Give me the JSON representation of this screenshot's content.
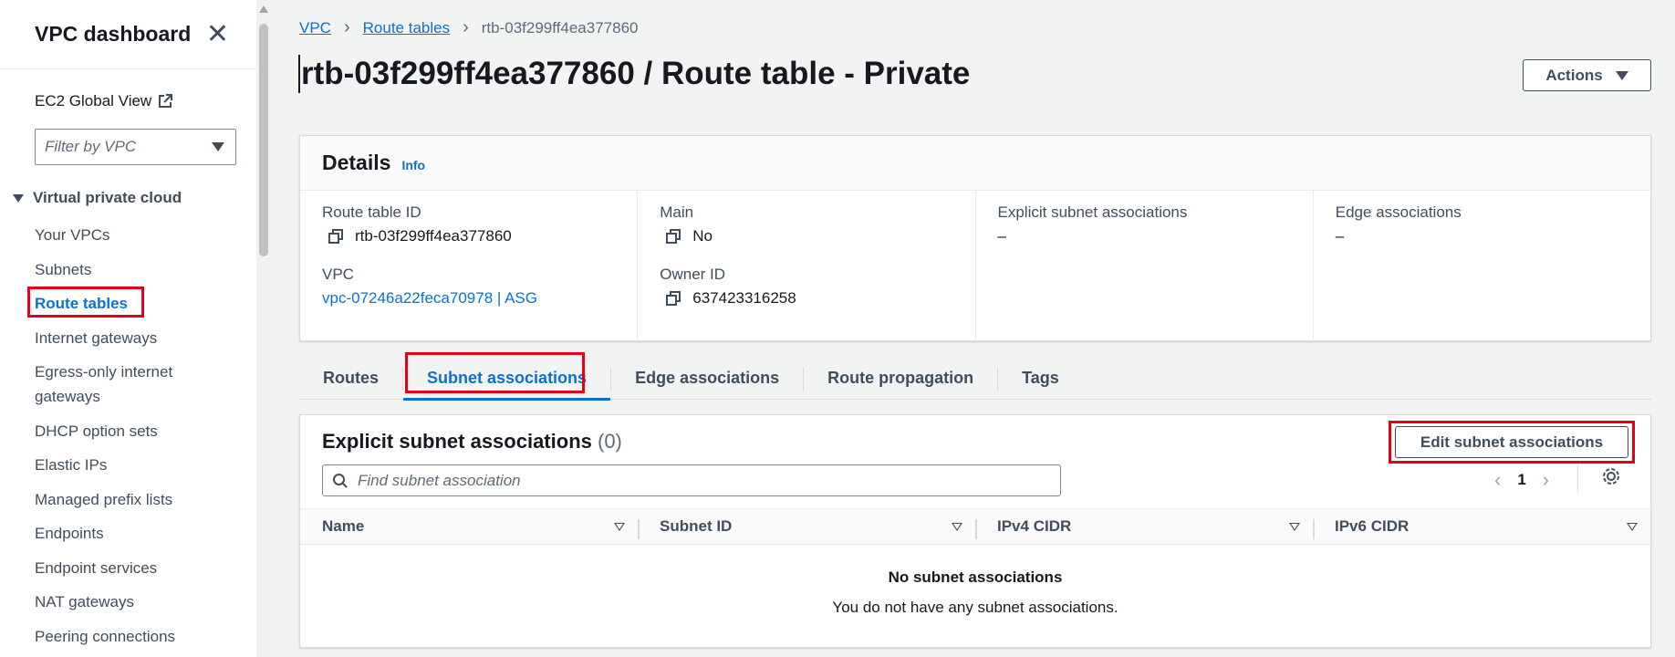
{
  "sidebar": {
    "title": "VPC dashboard",
    "ec2_global_view": "EC2 Global View",
    "filter_placeholder": "Filter by VPC",
    "section": "Virtual private cloud",
    "items": [
      {
        "label": "Your VPCs"
      },
      {
        "label": "Subnets"
      },
      {
        "label": "Route tables"
      },
      {
        "label": "Internet gateways"
      },
      {
        "label": "Egress-only internet gateways"
      },
      {
        "label": "DHCP option sets"
      },
      {
        "label": "Elastic IPs"
      },
      {
        "label": "Managed prefix lists"
      },
      {
        "label": "Endpoints"
      },
      {
        "label": "Endpoint services"
      },
      {
        "label": "NAT gateways"
      },
      {
        "label": "Peering connections"
      }
    ]
  },
  "breadcrumb": {
    "root": "VPC",
    "parent": "Route tables",
    "current": "rtb-03f299ff4ea377860"
  },
  "page": {
    "title": "rtb-03f299ff4ea377860 / Route table - Private",
    "actions_label": "Actions"
  },
  "details": {
    "heading": "Details",
    "info": "Info",
    "route_table_id_label": "Route table ID",
    "route_table_id": "rtb-03f299ff4ea377860",
    "vpc_label": "VPC",
    "vpc_value": "vpc-07246a22feca70978 | ASG",
    "main_label": "Main",
    "main_value": "No",
    "owner_label": "Owner ID",
    "owner_value": "637423316258",
    "explicit_label": "Explicit subnet associations",
    "explicit_value": "–",
    "edge_label": "Edge associations",
    "edge_value": "–"
  },
  "tabs": [
    {
      "label": "Routes"
    },
    {
      "label": "Subnet associations"
    },
    {
      "label": "Edge associations"
    },
    {
      "label": "Route propagation"
    },
    {
      "label": "Tags"
    }
  ],
  "associations": {
    "title": "Explicit subnet associations",
    "count": "(0)",
    "edit_label": "Edit subnet associations",
    "search_placeholder": "Find subnet association",
    "page": "1",
    "columns": [
      "Name",
      "Subnet ID",
      "IPv4 CIDR",
      "IPv6 CIDR"
    ],
    "empty_title": "No subnet associations",
    "empty_text": "You do not have any subnet associations."
  },
  "colors": {
    "link": "#0972d3",
    "highlight": "#e2001a"
  }
}
